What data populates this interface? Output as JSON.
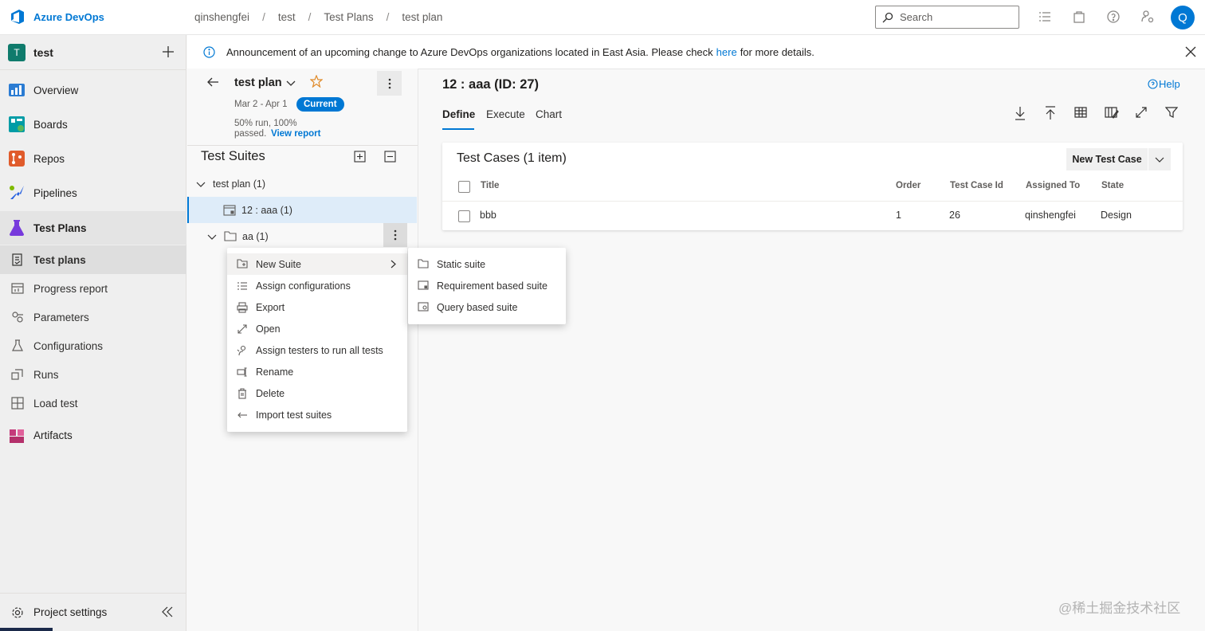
{
  "app": {
    "name": "Azure DevOps"
  },
  "breadcrumbs": [
    "qinshengfei",
    "test",
    "Test Plans",
    "test plan"
  ],
  "search": {
    "placeholder": "Search"
  },
  "user": {
    "initial": "Q"
  },
  "project": {
    "badge": "T",
    "name": "test"
  },
  "nav": {
    "items": [
      "Overview",
      "Boards",
      "Repos",
      "Pipelines",
      "Test Plans"
    ],
    "sub_items": [
      "Test plans",
      "Progress report",
      "Parameters",
      "Configurations",
      "Runs",
      "Load test"
    ],
    "artifacts": "Artifacts",
    "project_settings": "Project settings"
  },
  "banner": {
    "text": "Announcement of an upcoming change to Azure DevOps organizations located in East Asia. Please check",
    "link": "here",
    "text_after": "for more details."
  },
  "plan": {
    "name": "test plan",
    "dates": "Mar 2 - Apr 1",
    "badge": "Current",
    "summary_line1": "50% run, 100%",
    "summary_line2": "passed.",
    "view_report": "View report"
  },
  "suites": {
    "title": "Test Suites",
    "tree": [
      "test plan (1)",
      "12 : aaa (1)",
      "aa (1)"
    ]
  },
  "context_menu": {
    "items": [
      "New Suite",
      "Assign configurations",
      "Export",
      "Open",
      "Assign testers to run all tests",
      "Rename",
      "Delete",
      "Import test suites"
    ]
  },
  "submenu": {
    "items": [
      "Static suite",
      "Requirement based suite",
      "Query based suite"
    ]
  },
  "detail": {
    "title": "12 : aaa (ID: 27)",
    "help": "Help",
    "tabs": [
      "Define",
      "Execute",
      "Chart"
    ],
    "active_tab": "Define"
  },
  "test_cases": {
    "title": "Test Cases (1 item)",
    "new_button": "New Test Case",
    "columns": [
      "Title",
      "Order",
      "Test Case Id",
      "Assigned To",
      "State"
    ],
    "rows": [
      {
        "title": "bbb",
        "order": "1",
        "id": "26",
        "assigned": "qinshengfei",
        "state": "Design"
      }
    ]
  },
  "watermark": "@稀土掘金技术社区",
  "colors": {
    "accent": "#0078d4",
    "selected_row": "#deecf9",
    "nav_bg": "#efefef"
  }
}
